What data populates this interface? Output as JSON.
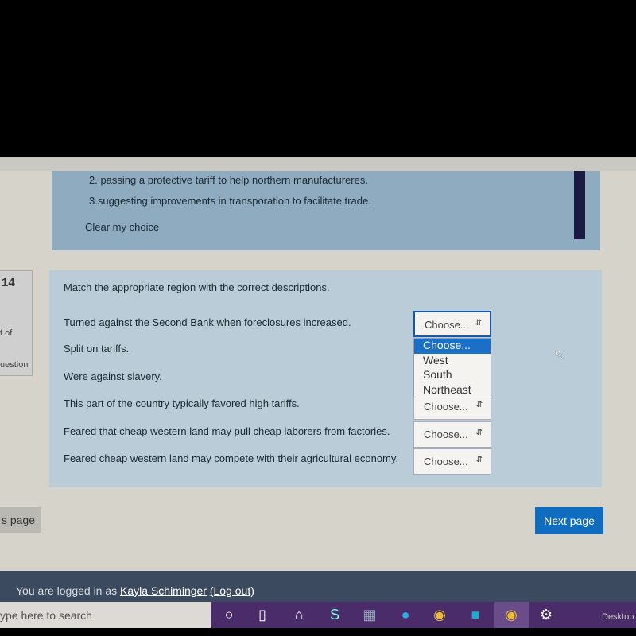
{
  "previous_question": {
    "options": [
      "2. passing a protective tariff to help northern manufactureres.",
      "3.suggesting improvements in transporation to facilitate trade."
    ],
    "clear_label": "Clear my choice"
  },
  "question_info": {
    "number": "14",
    "line1": "t of",
    "line2": "uestion"
  },
  "question": {
    "prompt": "Match the appropriate region with the correct descriptions.",
    "items": [
      {
        "text": "Turned against the Second Bank when foreclosures increased.",
        "selected": "Choose..."
      },
      {
        "text": "Split on tariffs.",
        "selected": "Choose..."
      },
      {
        "text": "Were against slavery.",
        "selected": "Choose..."
      },
      {
        "text": "This part of the country typically favored high tariffs.",
        "selected": "Choose..."
      },
      {
        "text": "Feared that cheap western land may pull cheap laborers from factories.",
        "selected": "Choose..."
      },
      {
        "text": "Feared cheap western land may compete with their agricultural economy.",
        "selected": "Choose..."
      }
    ],
    "dropdown_options": [
      "Choose...",
      "West",
      "South",
      "Northeast"
    ]
  },
  "nav": {
    "prev_label": "s page",
    "next_label": "Next page"
  },
  "footer": {
    "prefix": "You are logged in as ",
    "user": "Kayla Schiminger",
    "logout": "(Log out)"
  },
  "taskbar": {
    "search_placeholder": "ype here to search",
    "desktop_label": "Desktop"
  },
  "colors": {
    "accent": "#0f6cbf",
    "footer": "#3c4a60",
    "taskbar": "#4a2c6b"
  }
}
